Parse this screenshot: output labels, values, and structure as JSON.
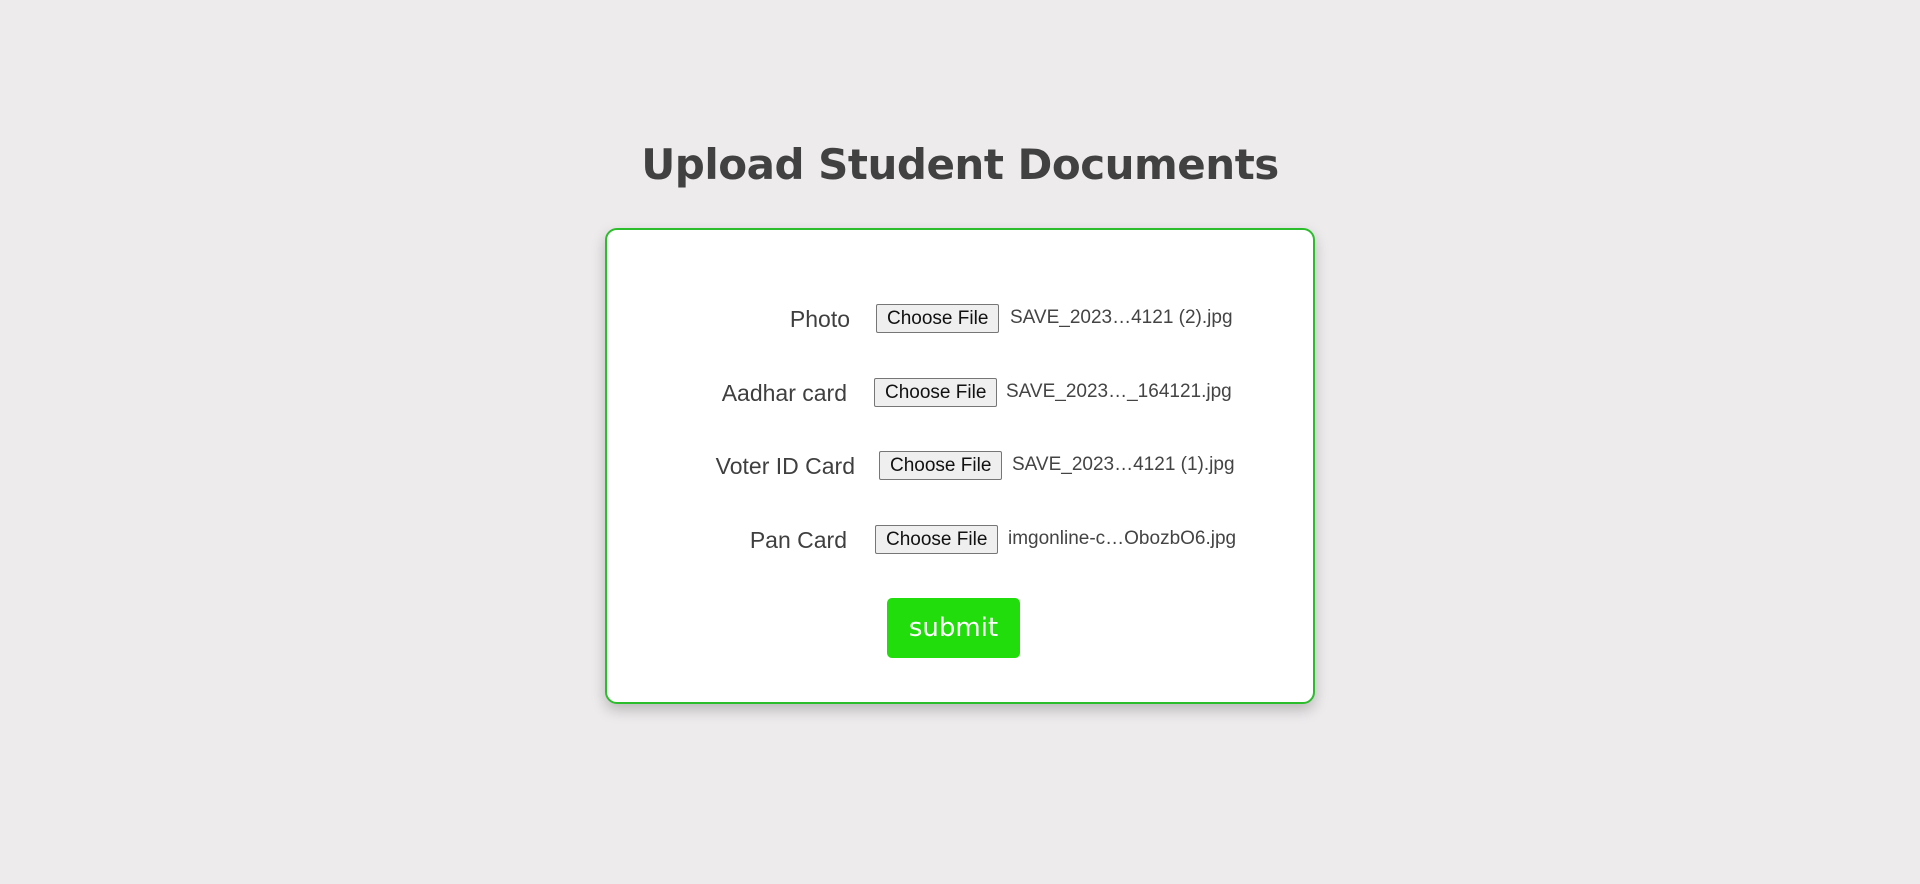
{
  "page": {
    "title": "Upload Student Documents"
  },
  "form": {
    "rows": [
      {
        "label": "Photo",
        "button_label": "Choose File",
        "file_name": "SAVE_2023…4121 (2).jpg"
      },
      {
        "label": "Aadhar card",
        "button_label": "Choose File",
        "file_name": "SAVE_2023…_164121.jpg"
      },
      {
        "label": "Voter ID Card",
        "button_label": "Choose File",
        "file_name": "SAVE_2023…4121 (1).jpg"
      },
      {
        "label": "Pan Card",
        "button_label": "Choose File",
        "file_name": "imgonline-c…ObozbO6.jpg"
      }
    ],
    "submit_label": "submit"
  },
  "colors": {
    "background": "#edebec",
    "card_border": "#2bbd2b",
    "submit_background": "#22dd0c"
  }
}
